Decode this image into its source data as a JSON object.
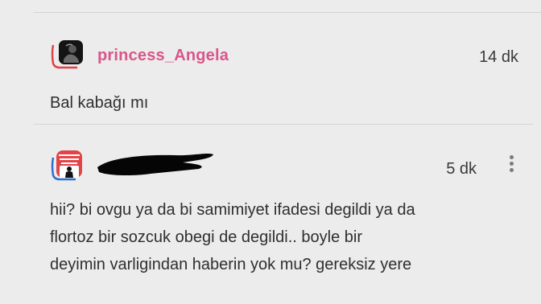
{
  "comments": [
    {
      "username": "princess_Angela",
      "time": "14 dk",
      "text_lines": [
        "Bal kabağı mı"
      ]
    },
    {
      "username": "",
      "username_redacted": true,
      "time": "5 dk",
      "text_lines": [
        "hii? bi ovgu ya da bi samimiyet ifadesi degildi ya da",
        "flortoz bir sozcuk obegi de degildi.. boyle bir",
        "deyimin varligindan haberin yok mu? gereksiz yere"
      ]
    }
  ],
  "colors": {
    "username": "#d9568a",
    "avatar_ring": "#e0404a",
    "background": "#ececec"
  },
  "icons": {
    "comment_menu": "more-vertical-icon"
  }
}
